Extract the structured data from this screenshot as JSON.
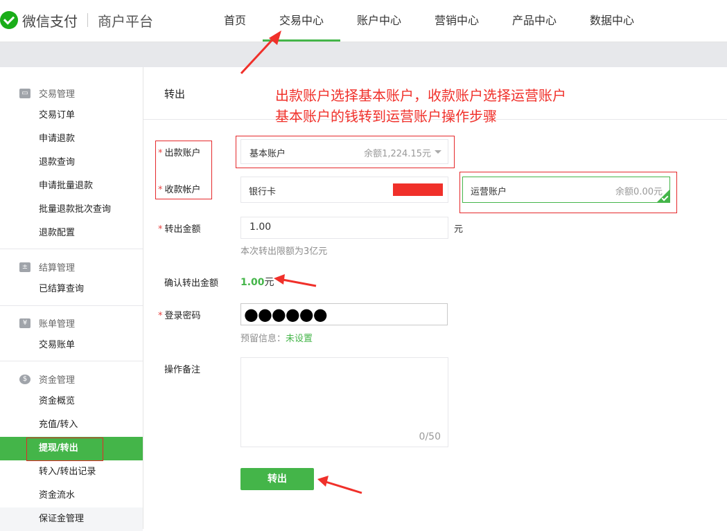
{
  "header": {
    "brand": "微信支付",
    "platform": "商户平台",
    "nav": [
      "首页",
      "交易中心",
      "账户中心",
      "营销中心",
      "产品中心",
      "数据中心"
    ],
    "active_nav": "交易中心"
  },
  "sidebar": {
    "sections": [
      {
        "title": "交易管理",
        "icon": "card-icon",
        "items": [
          "交易订单",
          "申请退款",
          "退款查询",
          "申请批量退款",
          "批量退款批次查询",
          "退款配置"
        ]
      },
      {
        "title": "结算管理",
        "icon": "calculator-icon",
        "items": [
          "已结算查询"
        ]
      },
      {
        "title": "账单管理",
        "icon": "yen-icon",
        "items": [
          "交易账单"
        ]
      },
      {
        "title": "资金管理",
        "icon": "money-bag-icon",
        "items": [
          "资金概览",
          "充值/转入",
          "提现/转出",
          "转入/转出记录",
          "资金流水",
          "保证金管理"
        ]
      }
    ],
    "active_item": "提现/转出"
  },
  "page": {
    "title": "转出",
    "annotation_line1": "出款账户选择基本账户，收款账户选择运营账户",
    "annotation_line2": "基本账户的钱转到运营账户操作步骤"
  },
  "form": {
    "from_label": "出款账户",
    "from_value": "基本账户",
    "from_balance": "余额1,224.15元",
    "to_label": "收款帐户",
    "to_bank": "银行卡",
    "to_selected": "运营账户",
    "to_selected_balance": "余额0.00元",
    "amount_label": "转出金额",
    "amount_value": "1.00",
    "amount_unit": "元",
    "amount_hint": "本次转出限额为3亿元",
    "confirm_label": "确认转出金额",
    "confirm_value": "1.00",
    "confirm_unit": "元",
    "password_label": "登录密码",
    "password_mask": "●●●●●●",
    "reserved_prefix": "预留信息：",
    "reserved_value": "未设置",
    "remark_label": "操作备注",
    "remark_counter": "0/50",
    "submit_label": "转出"
  },
  "colors": {
    "accent": "#44b549",
    "annotation": "#f0302a"
  }
}
